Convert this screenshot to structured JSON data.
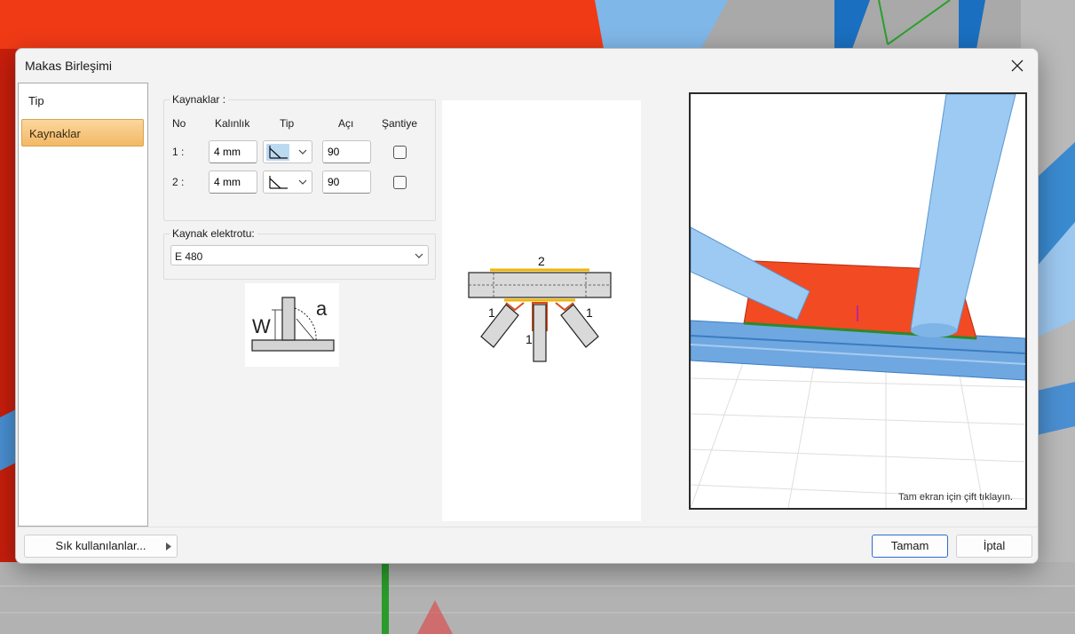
{
  "window": {
    "title": "Makas Birleşimi"
  },
  "nav": {
    "items": [
      {
        "label": "Tip"
      },
      {
        "label": "Kaynaklar"
      }
    ],
    "active": 1
  },
  "welds": {
    "group_title": "Kaynaklar :",
    "headers": {
      "no": "No",
      "thickness": "Kalınlık",
      "type": "Tip",
      "angle": "Açı",
      "site": "Şantiye"
    },
    "rows": [
      {
        "no": "1 :",
        "thickness": "4 mm",
        "angle": "90",
        "site_checked": false
      },
      {
        "no": "2 :",
        "thickness": "4 mm",
        "angle": "90",
        "site_checked": false
      }
    ]
  },
  "electrode": {
    "group_title": "Kaynak elektrotu:",
    "value": "E 480"
  },
  "weld_symbol": {
    "w_label": "W",
    "a_label": "a"
  },
  "truss_diagram": {
    "label_top": "2",
    "label_left": "1",
    "label_mid": "1",
    "label_right": "1"
  },
  "preview": {
    "hint": "Tam ekran için çift tıklayın."
  },
  "footer": {
    "favorites_label": "Sık kullanılanlar...",
    "ok_label": "Tamam",
    "cancel_label": "İptal"
  },
  "colors": {
    "accent_orange": "#f2b865",
    "plate_red": "#f24a22",
    "steel_blue": "#5a9ede",
    "weld_yellow": "#f0b400",
    "primary_border": "#2a6ad2"
  }
}
